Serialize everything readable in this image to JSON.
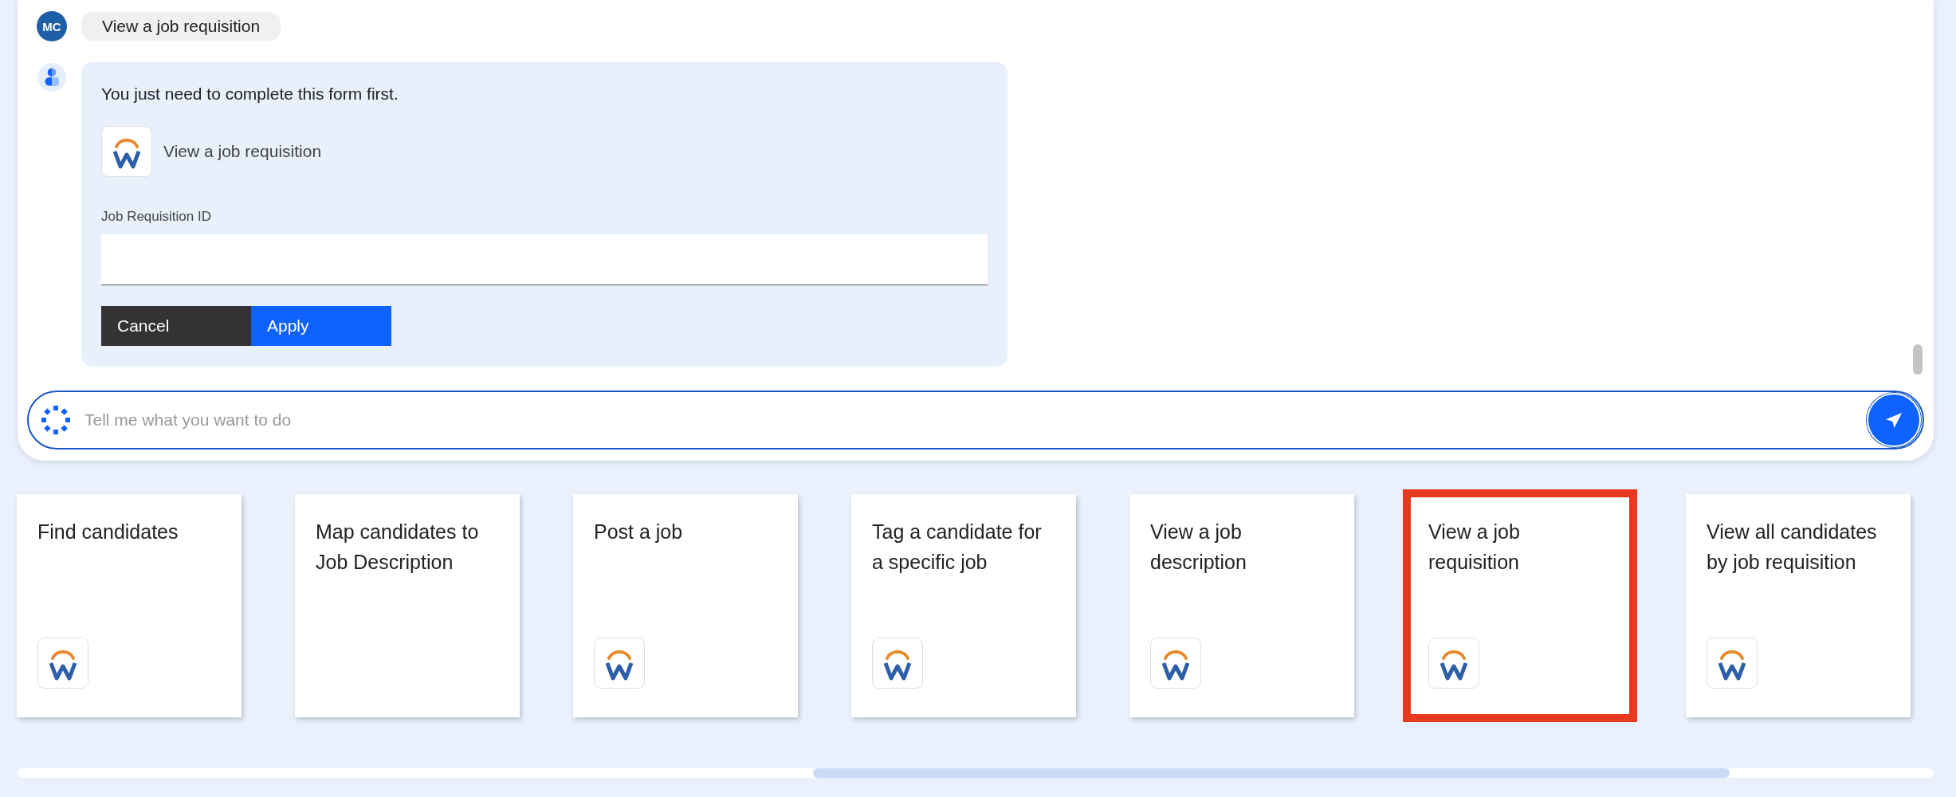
{
  "chat": {
    "user_message": {
      "avatar": "MC",
      "text": "View a job requisition"
    },
    "bot_message": {
      "text": "You just need to complete this form first.",
      "app_label": "View a job requisition",
      "field_label": "Job Requisition ID",
      "buttons": [
        {
          "label": "Cancel",
          "kind": "secondary"
        },
        {
          "label": "Apply",
          "kind": "primary"
        }
      ]
    }
  },
  "prompt": {
    "placeholder": "Tell me what you want to do"
  },
  "cards": [
    {
      "title": "Find candidates",
      "logo": true,
      "selected": false
    },
    {
      "title": "Map candidates to Job Description",
      "logo": false,
      "selected": false
    },
    {
      "title": "Post a job",
      "logo": true,
      "selected": false
    },
    {
      "title": "Tag a candidate for a specific job",
      "logo": true,
      "selected": false
    },
    {
      "title": "View a job description",
      "logo": true,
      "selected": false
    },
    {
      "title": "View a job requisition",
      "logo": true,
      "selected": true
    },
    {
      "title": "View all candidates by job requisition",
      "logo": true,
      "selected": false
    }
  ]
}
